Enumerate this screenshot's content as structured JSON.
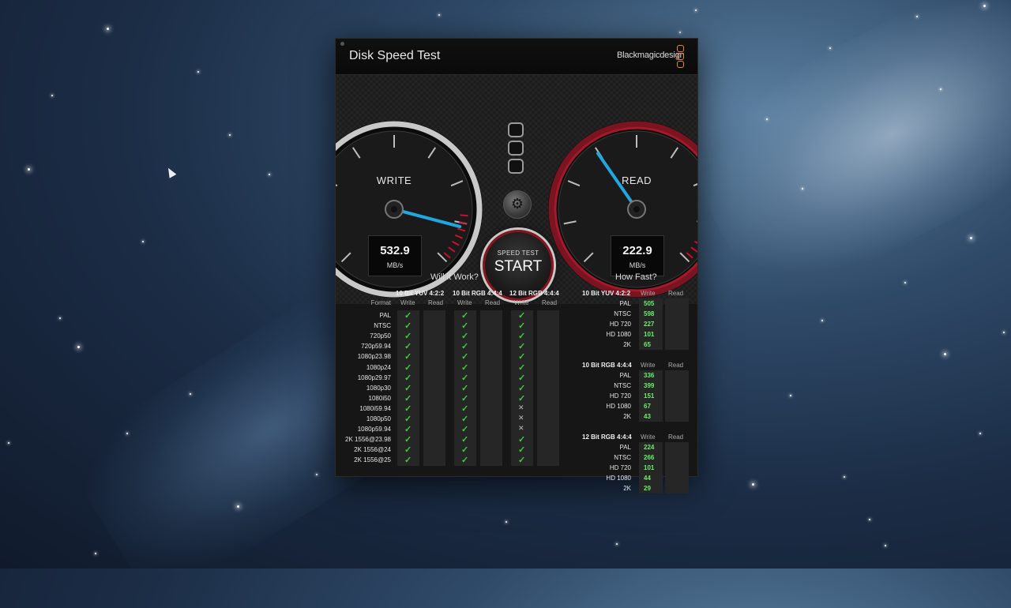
{
  "window": {
    "title": "Disk Speed Test",
    "brand": "Blackmagicdesign",
    "accent_color": "#c8102e",
    "needle_color": "#21a7df"
  },
  "gauges": {
    "write": {
      "label": "WRITE",
      "value": "532.9",
      "unit": "MB/s"
    },
    "read": {
      "label": "READ",
      "value": "222.9",
      "unit": "MB/s"
    }
  },
  "start_button": {
    "small": "SPEED TEST",
    "big": "START"
  },
  "will_it_work": {
    "heading": "Will it Work?",
    "format_label": "Format",
    "groups": [
      "10 Bit YUV 4:2:2",
      "10 Bit RGB 4:4:4",
      "12 Bit RGB 4:4:4"
    ],
    "write_label": "Write",
    "read_label": "Read",
    "rows": [
      {
        "format": "PAL",
        "w": [
          "ok",
          "ok",
          "ok"
        ]
      },
      {
        "format": "NTSC",
        "w": [
          "ok",
          "ok",
          "ok"
        ]
      },
      {
        "format": "720p50",
        "w": [
          "ok",
          "ok",
          "ok"
        ]
      },
      {
        "format": "720p59.94",
        "w": [
          "ok",
          "ok",
          "ok"
        ]
      },
      {
        "format": "1080p23.98",
        "w": [
          "ok",
          "ok",
          "ok"
        ]
      },
      {
        "format": "1080p24",
        "w": [
          "ok",
          "ok",
          "ok"
        ]
      },
      {
        "format": "1080p29.97",
        "w": [
          "ok",
          "ok",
          "ok"
        ]
      },
      {
        "format": "1080p30",
        "w": [
          "ok",
          "ok",
          "ok"
        ]
      },
      {
        "format": "1080i50",
        "w": [
          "ok",
          "ok",
          "ok"
        ]
      },
      {
        "format": "1080i59.94",
        "w": [
          "ok",
          "ok",
          "no"
        ]
      },
      {
        "format": "1080p50",
        "w": [
          "ok",
          "ok",
          "no"
        ]
      },
      {
        "format": "1080p59.94",
        "w": [
          "ok",
          "ok",
          "no"
        ]
      },
      {
        "format": "2K 1556@23.98",
        "w": [
          "ok",
          "ok",
          "ok"
        ]
      },
      {
        "format": "2K 1556@24",
        "w": [
          "ok",
          "ok",
          "ok"
        ]
      },
      {
        "format": "2K 1556@25",
        "w": [
          "ok",
          "ok",
          "ok"
        ]
      }
    ]
  },
  "how_fast": {
    "heading": "How Fast?",
    "write_label": "Write",
    "read_label": "Read",
    "groups": [
      {
        "name": "10 Bit YUV 4:2:2",
        "rows": [
          {
            "format": "PAL",
            "write": "505"
          },
          {
            "format": "NTSC",
            "write": "598"
          },
          {
            "format": "HD 720",
            "write": "227"
          },
          {
            "format": "HD 1080",
            "write": "101"
          },
          {
            "format": "2K",
            "write": "65"
          }
        ]
      },
      {
        "name": "10 Bit RGB 4:4:4",
        "rows": [
          {
            "format": "PAL",
            "write": "336"
          },
          {
            "format": "NTSC",
            "write": "399"
          },
          {
            "format": "HD 720",
            "write": "151"
          },
          {
            "format": "HD 1080",
            "write": "67"
          },
          {
            "format": "2K",
            "write": "43"
          }
        ]
      },
      {
        "name": "12 Bit RGB 4:4:4",
        "rows": [
          {
            "format": "PAL",
            "write": "224"
          },
          {
            "format": "NTSC",
            "write": "266"
          },
          {
            "format": "HD 720",
            "write": "101"
          },
          {
            "format": "HD 1080",
            "write": "44"
          },
          {
            "format": "2K",
            "write": "29"
          }
        ]
      }
    ]
  }
}
